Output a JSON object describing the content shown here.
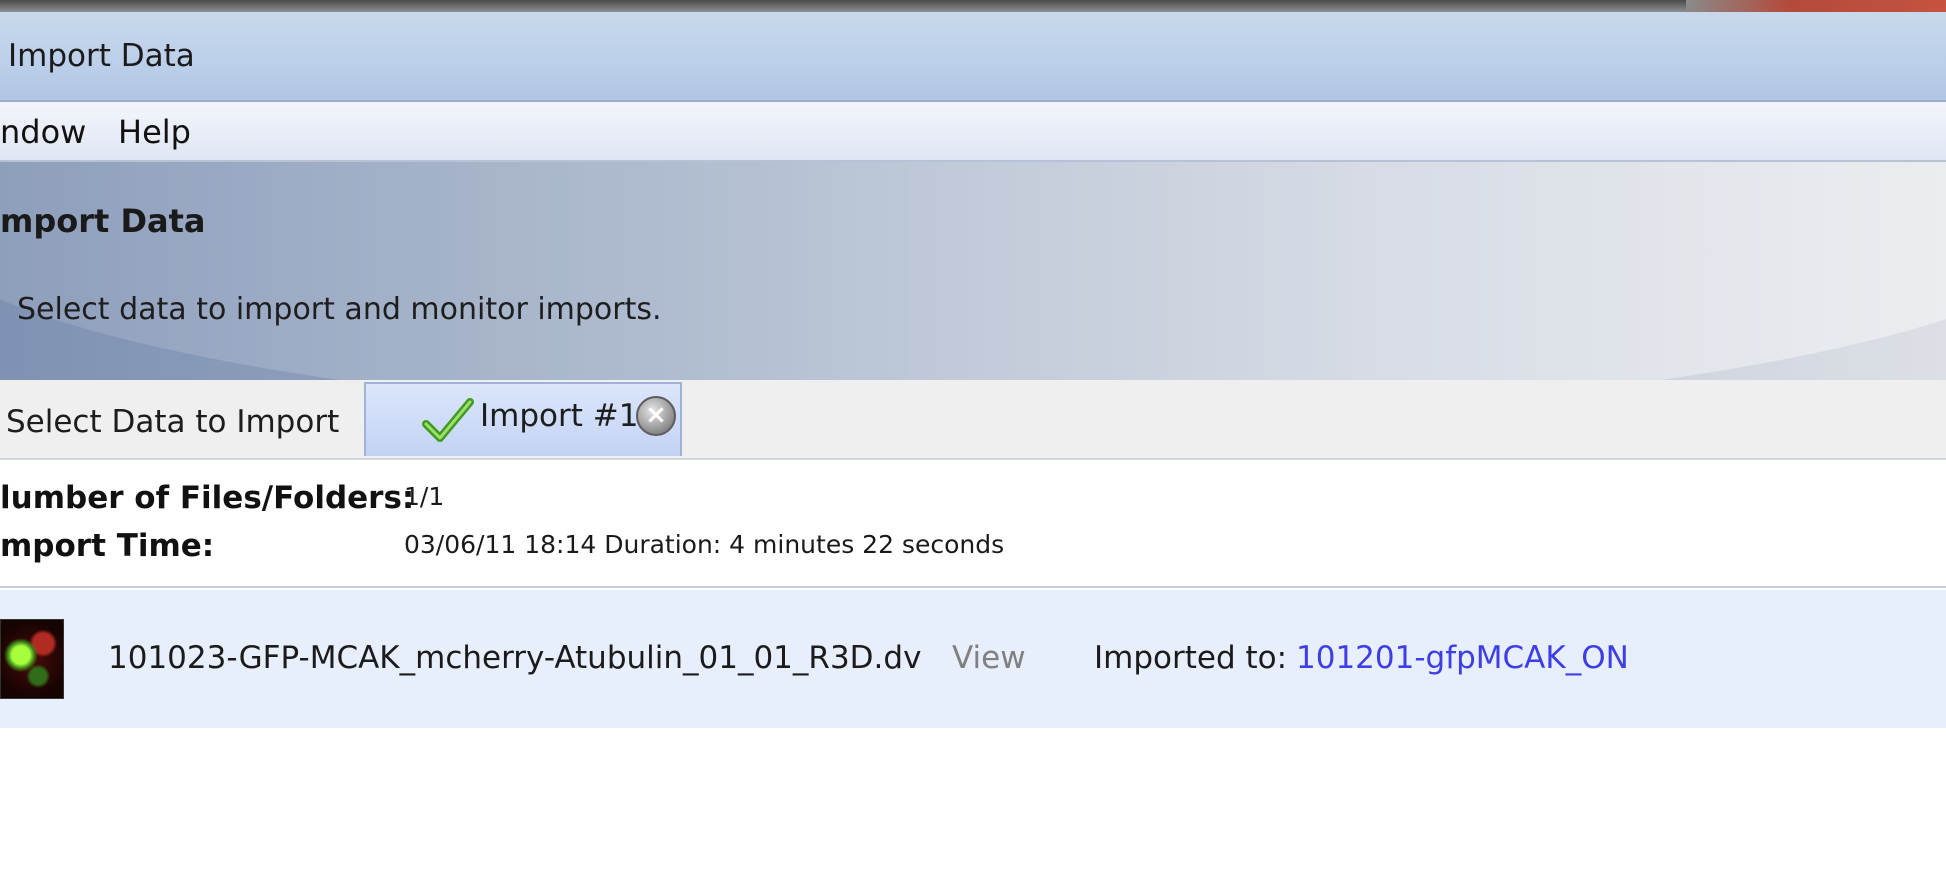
{
  "window": {
    "title": "Import Data"
  },
  "menu": {
    "items": [
      "ndow",
      "Help"
    ]
  },
  "banner": {
    "heading": "mport Data",
    "subtitle": "Select data to import and monitor imports."
  },
  "tabs": [
    {
      "label": "Select Data to Import"
    },
    {
      "label": "Import #1",
      "icon": "checkmark-icon",
      "close_icon": "close-icon"
    }
  ],
  "summary": {
    "files_label": "lumber of Files/Folders:",
    "files_value": "1/1",
    "time_label": "mport Time:",
    "time_value": "03/06/11 18:14 Duration:  4 minutes 22 seconds"
  },
  "imports": [
    {
      "thumbnail": "microscopy-thumbnail",
      "filename": "101023-GFP-MCAK_mcherry-Atubulin_01_01_R3D.dv",
      "view_label": "View",
      "imported_to_label": "Imported to:",
      "destination": "101201-gfpMCAK_ON"
    }
  ],
  "colors": {
    "link": "#3e3ee6",
    "row_background": "#e8effc",
    "active_tab": "#c3d3f4"
  }
}
